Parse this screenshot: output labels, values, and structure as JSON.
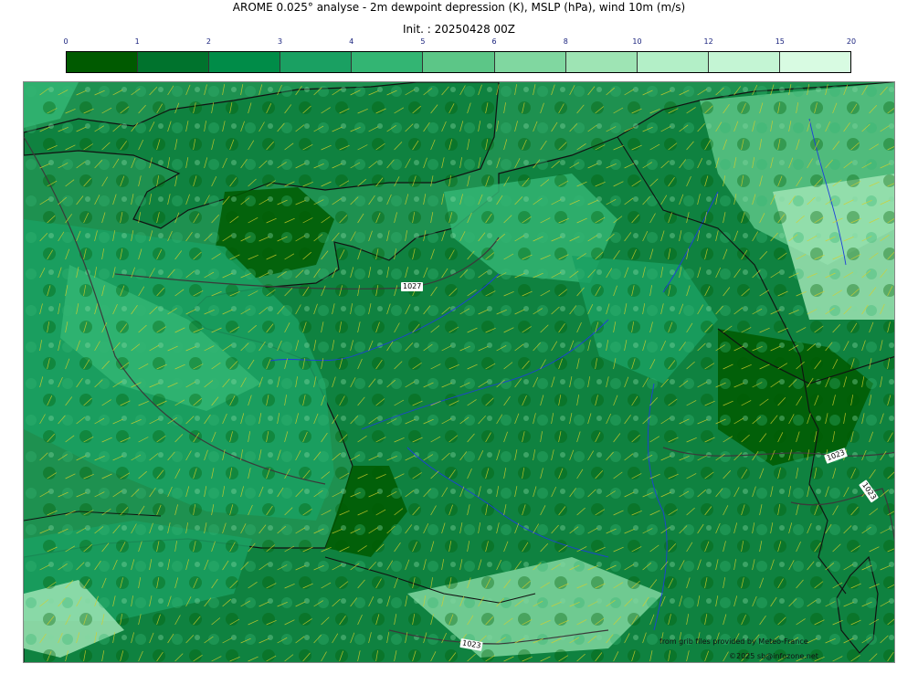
{
  "title": "AROME 0.025° analyse - 2m dewpoint depression (K), MSLP (hPa), wind 10m (m/s)",
  "init": "Init. : 20250428 00Z",
  "colorbar": {
    "ticks": [
      "0",
      "1",
      "2",
      "3",
      "4",
      "5",
      "6",
      "8",
      "10",
      "12",
      "15",
      "20"
    ],
    "colors": [
      "#005a00",
      "#00732d",
      "#008c48",
      "#1aa062",
      "#33b573",
      "#5cc687",
      "#80d7a0",
      "#9ee4b4",
      "#b3efc7",
      "#c4f5d4",
      "#d8fbe2"
    ]
  },
  "map": {
    "sea_color": "#1e9150",
    "land_base": "#0f8240",
    "coast_color": "#111111",
    "river_color": "#1e3fd8",
    "barb_color": "#d6d02a",
    "isobar_color": "#3a3a3a",
    "isobar_labels": [
      "1027",
      "1023",
      "1023",
      "1023"
    ]
  },
  "credits": {
    "source": "from grib files provided by  Meteo-France",
    "copyright": "©2025 sb@infozone.net"
  }
}
